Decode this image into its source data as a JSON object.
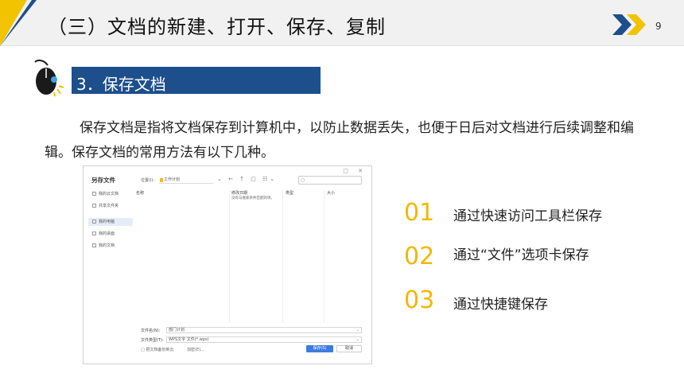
{
  "header": {
    "title": "（三）文档的新建、打开、保存、复制",
    "page_number": "9",
    "accent_blue": "#1d4f8c",
    "accent_yellow": "#f2c300"
  },
  "section": {
    "label": "3．保存文档",
    "icon": "mouse-icon"
  },
  "paragraph": "保存文档是指将文档保存到计算机中，以防止数据丢失，也便于日后对文档进行后续调整和编辑。保存文档的常用方法有以下几种。",
  "dialog": {
    "title": "另存文件",
    "location_label": "位置(I):",
    "location_value": "工作计划",
    "nav_icons": "⌄ ← ↑ ▢ ☷⌄",
    "sidebar": [
      {
        "label": "我的云文档"
      },
      {
        "label": "共享文件夹"
      },
      {
        "label": "我的电脑"
      },
      {
        "label": "我的桌面"
      },
      {
        "label": "我的文档"
      }
    ],
    "columns": [
      "名称",
      "修改日期",
      "类型",
      "大小"
    ],
    "empty_message": "没有与搜索条件匹配的项。",
    "filename_label": "文件名(N):",
    "filename_value": "部门计划",
    "filetype_label": "文件类型(T):",
    "filetype_value": "WPS文字 文件(*.wps)",
    "backup_label": "□ 把文档备份到云",
    "encrypt_label": "加密(E)...",
    "save_label": "保存(S)",
    "cancel_label": "取消"
  },
  "methods": [
    {
      "number": "01",
      "text": "通过快速访问工具栏保存"
    },
    {
      "number": "02",
      "text": "通过“文件”选项卡保存"
    },
    {
      "number": "03",
      "text": "通过快捷键保存"
    }
  ]
}
